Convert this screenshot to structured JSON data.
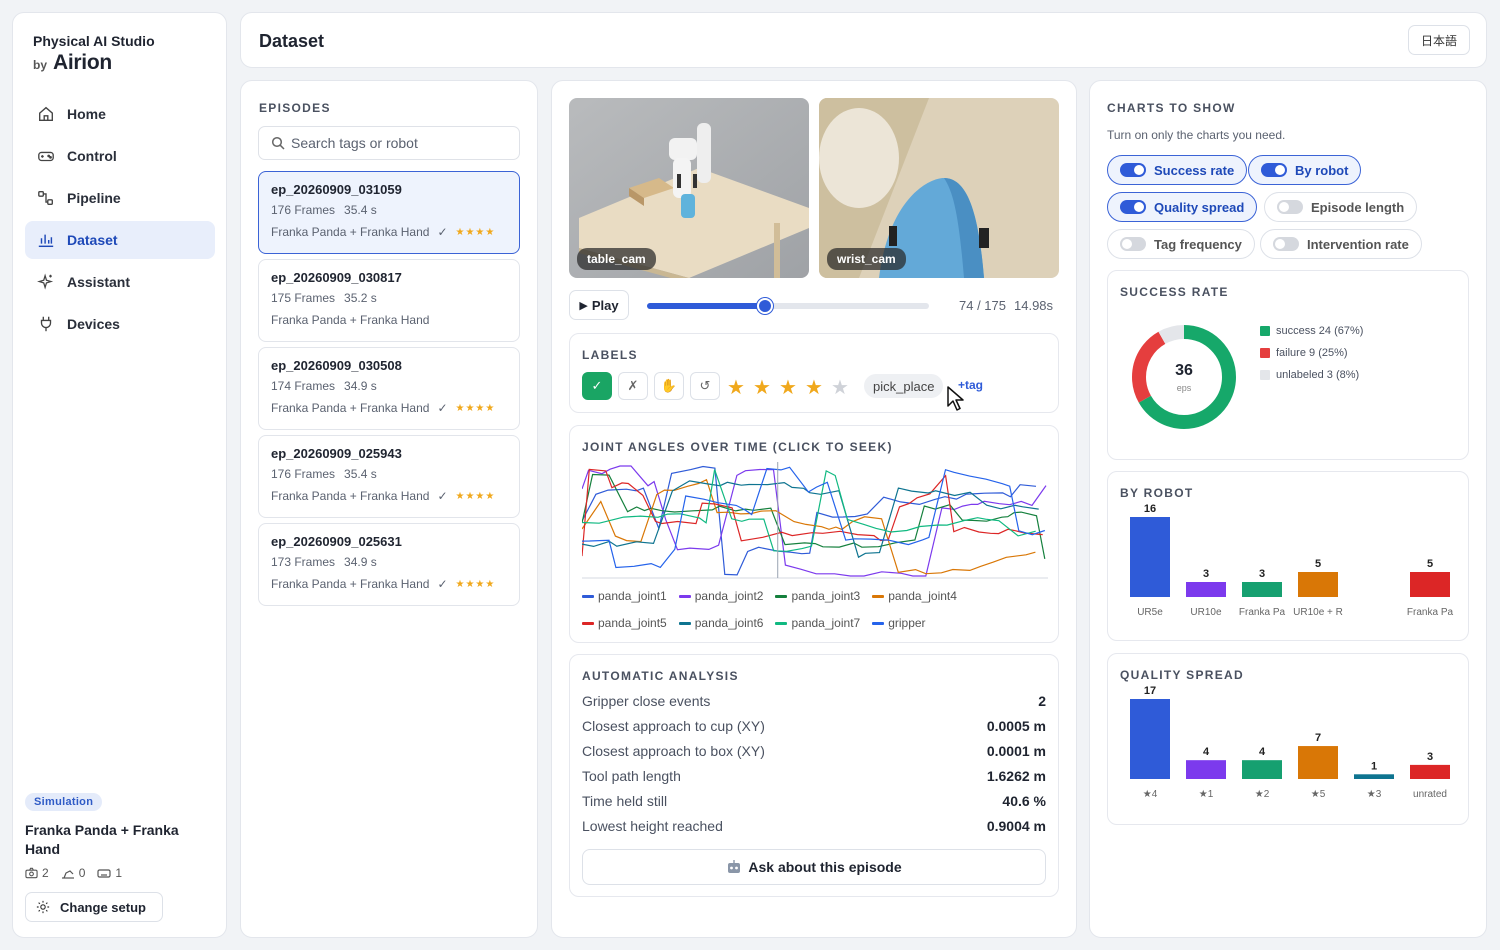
{
  "sidebar": {
    "brand_title": "Physical AI Studio",
    "brand_by": "by",
    "brand_logo": "Airion",
    "nav": [
      {
        "label": "Home",
        "icon": "home-icon"
      },
      {
        "label": "Control",
        "icon": "gamepad-icon"
      },
      {
        "label": "Pipeline",
        "icon": "pipeline-icon"
      },
      {
        "label": "Dataset",
        "icon": "chart-icon",
        "active": true
      },
      {
        "label": "Assistant",
        "icon": "sparkle-icon"
      },
      {
        "label": "Devices",
        "icon": "plug-icon"
      }
    ],
    "mode_badge": "Simulation",
    "robot_name": "Franka Panda + Franka Hand",
    "stats": {
      "cameras": "2",
      "arms": "0",
      "keyboards": "1"
    },
    "change_setup": "Change setup"
  },
  "header": {
    "title": "Dataset",
    "language": "日本語"
  },
  "episodes": {
    "title": "EPISODES",
    "search_placeholder": "Search tags or robot",
    "items": [
      {
        "id": "ep_20260909_031059",
        "frames": "176 Frames",
        "duration": "35.4 s",
        "robot": "Franka Panda + Franka Hand",
        "check": "✓",
        "stars": "★★★★",
        "selected": true
      },
      {
        "id": "ep_20260909_030817",
        "frames": "175 Frames",
        "duration": "35.2 s",
        "robot": "Franka Panda + Franka Hand",
        "check": "",
        "stars": ""
      },
      {
        "id": "ep_20260909_030508",
        "frames": "174 Frames",
        "duration": "34.9 s",
        "robot": "Franka Panda + Franka Hand",
        "check": "✓",
        "stars": "★★★★"
      },
      {
        "id": "ep_20260909_025943",
        "frames": "176 Frames",
        "duration": "35.4 s",
        "robot": "Franka Panda + Franka Hand",
        "check": "✓",
        "stars": "★★★★"
      },
      {
        "id": "ep_20260909_025631",
        "frames": "173 Frames",
        "duration": "34.9 s",
        "robot": "Franka Panda + Franka Hand",
        "check": "✓",
        "stars": "★★★★"
      }
    ]
  },
  "player": {
    "cam1": "table_cam",
    "cam2": "wrist_cam",
    "play_label": "Play",
    "frame": "74 / 175",
    "time": "14.98s",
    "progress": 0.42
  },
  "labels": {
    "title": "LABELS",
    "rating": 4,
    "rating_max": 5,
    "tag": "pick_place",
    "add_tag": "+tag"
  },
  "joint_chart_title": "JOINT ANGLES OVER TIME (CLICK TO SEEK)",
  "chart_data": [
    {
      "type": "line",
      "title": "JOINT ANGLES OVER TIME (CLICK TO SEEK)",
      "series": [
        {
          "name": "panda_joint1",
          "color": "#2f5bd8"
        },
        {
          "name": "panda_joint2",
          "color": "#7c3aed"
        },
        {
          "name": "panda_joint3",
          "color": "#15803d"
        },
        {
          "name": "panda_joint4",
          "color": "#d97706"
        },
        {
          "name": "panda_joint5",
          "color": "#dc2626"
        },
        {
          "name": "panda_joint6",
          "color": "#0e7490"
        },
        {
          "name": "panda_joint7",
          "color": "#10b981"
        },
        {
          "name": "gripper",
          "color": "#2563eb"
        }
      ]
    },
    {
      "type": "pie",
      "title": "SUCCESS RATE",
      "center_value": "36",
      "center_label": "eps",
      "slices": [
        {
          "label": "success 24 (67%)",
          "value": 24,
          "color": "#16a86a"
        },
        {
          "label": "failure 9 (25%)",
          "value": 9,
          "color": "#e53e3e"
        },
        {
          "label": "unlabeled 3 (8%)",
          "value": 3,
          "color": "#e4e6ea"
        }
      ]
    },
    {
      "type": "bar",
      "title": "BY ROBOT",
      "categories": [
        "UR5e",
        "UR10e",
        "Franka Pa",
        "UR10e + R",
        "",
        "Franka Pa"
      ],
      "values": [
        16,
        3,
        3,
        5,
        null,
        5
      ],
      "colors": [
        "#2f5bd8",
        "#7c3aed",
        "#16a070",
        "#d97706",
        "",
        "#dc2626"
      ],
      "ylim": [
        0,
        16
      ]
    },
    {
      "type": "bar",
      "title": "QUALITY SPREAD",
      "categories": [
        "★4",
        "★1",
        "★2",
        "★5",
        "★3",
        "unrated"
      ],
      "values": [
        17,
        4,
        4,
        7,
        1,
        3
      ],
      "colors": [
        "#2f5bd8",
        "#7c3aed",
        "#16a070",
        "#d97706",
        "#0e7490",
        "#dc2626"
      ],
      "ylim": [
        0,
        17
      ]
    }
  ],
  "analysis": {
    "title": "AUTOMATIC ANALYSIS",
    "rows": [
      {
        "label": "Gripper close events",
        "value": "2"
      },
      {
        "label": "Closest approach to cup (XY)",
        "value": "0.0005 m"
      },
      {
        "label": "Closest approach to box (XY)",
        "value": "0.0001 m"
      },
      {
        "label": "Tool path length",
        "value": "1.6262 m"
      },
      {
        "label": "Time held still",
        "value": "40.6 %"
      },
      {
        "label": "Lowest height reached",
        "value": "0.9004 m"
      }
    ],
    "ask_button": "Ask about this episode"
  },
  "charts_panel": {
    "title": "CHARTS TO SHOW",
    "subtitle": "Turn on only the charts you need.",
    "toggles": [
      {
        "label": "Success rate",
        "on": true
      },
      {
        "label": "By robot",
        "on": true
      },
      {
        "label": "Quality spread",
        "on": true
      },
      {
        "label": "Episode length",
        "on": false
      },
      {
        "label": "Tag frequency",
        "on": false
      },
      {
        "label": "Intervention rate",
        "on": false
      }
    ]
  }
}
